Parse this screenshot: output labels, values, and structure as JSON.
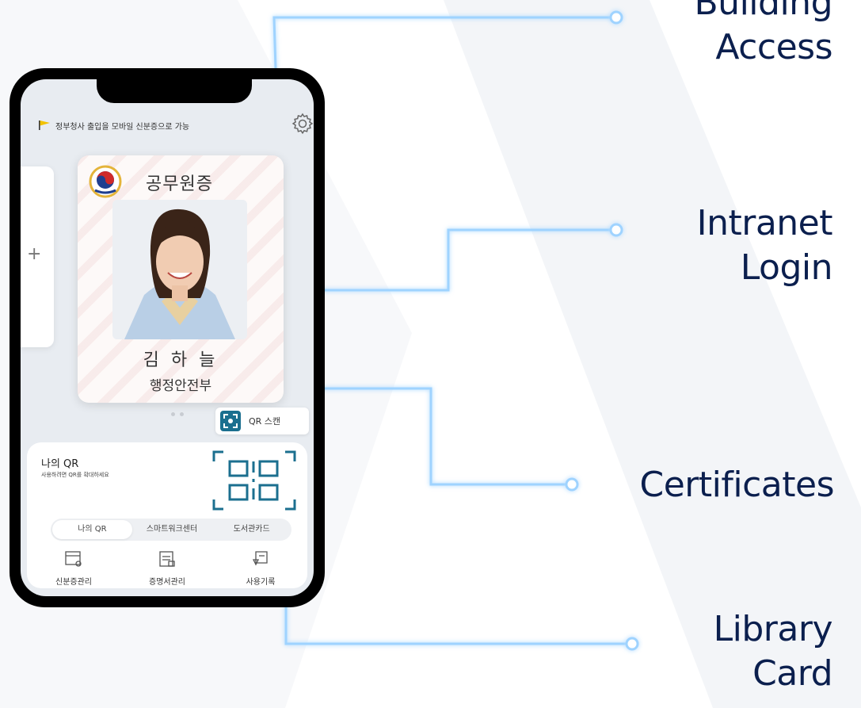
{
  "phone": {
    "notice_text": "정부청사 출입을 모바일 신분증으로 가능",
    "card": {
      "title": "공무원증",
      "name": "김 하 늘",
      "department": "행정안전부"
    },
    "side_card_plus": "+",
    "qr_scan_label": "QR 스캔",
    "my_qr": {
      "title": "나의 QR",
      "subtitle": "사용하려면 QR를 확대하세요"
    },
    "tabs": [
      {
        "label": "나의 QR",
        "active": true
      },
      {
        "label": "스마트워크센터",
        "active": false
      },
      {
        "label": "도서관카드",
        "active": false
      }
    ],
    "menu": [
      {
        "label": "신분증관리",
        "icon": "id-card-icon"
      },
      {
        "label": "증명서관리",
        "icon": "certificate-icon"
      },
      {
        "label": "사용기록",
        "icon": "history-icon"
      }
    ]
  },
  "features": {
    "building_line1": "Building",
    "building_line2": "Access",
    "intranet_line1": "Intranet",
    "intranet_line2": "Login",
    "certificates": "Certificates",
    "library_line1": "Library",
    "library_line2": "Card"
  },
  "colors": {
    "label_navy": "#0b1f4e",
    "connector_glow": "#9fd3ff",
    "accent_teal": "#1b6f8f",
    "screen_bg": "#e8ecf1"
  }
}
